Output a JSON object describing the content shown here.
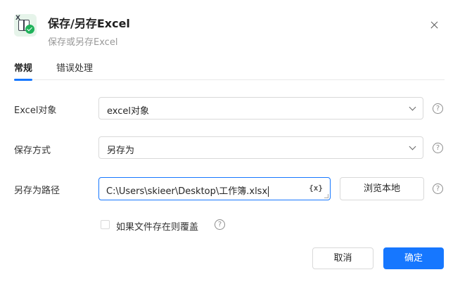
{
  "header": {
    "title": "保存/另存Excel",
    "subtitle": "保存或另存Excel",
    "app_icon": "excel-save-icon",
    "close_icon": "close-icon"
  },
  "tabs": [
    {
      "label": "常规",
      "active": true
    },
    {
      "label": "错误处理",
      "active": false
    }
  ],
  "form": {
    "excel_object": {
      "label": "Excel对象",
      "value": "excel对象"
    },
    "save_mode": {
      "label": "保存方式",
      "value": "另存为"
    },
    "save_path": {
      "label": "另存为路径",
      "value": "C:\\Users\\skieer\\Desktop\\工作簿.xlsx",
      "var_button": "{x}"
    },
    "browse_label": "浏览本地",
    "overwrite": {
      "label": "如果文件存在则覆盖",
      "checked": false
    },
    "help_glyph": "?"
  },
  "footer": {
    "cancel_label": "取消",
    "ok_label": "确定"
  },
  "colors": {
    "accent": "#1677ff",
    "icon_bg": "#e6f4ea",
    "icon_check": "#1fb25a"
  }
}
